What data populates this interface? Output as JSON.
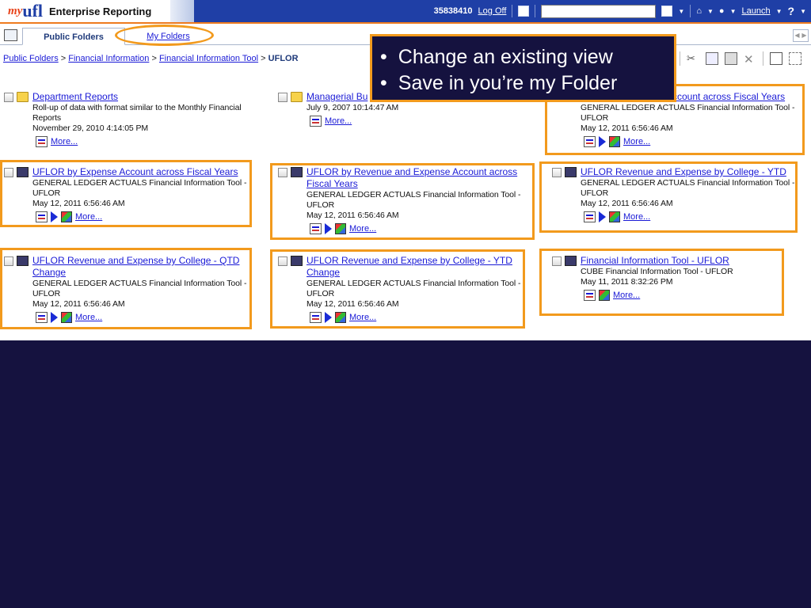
{
  "header": {
    "logo_my": "my",
    "logo_ufl": "ufl",
    "app_title": "Enterprise Reporting",
    "user_id": "35838410",
    "logoff_label": "Log Off",
    "launch_label": "Launch",
    "help_label": "?"
  },
  "tabs": {
    "public_folders": "Public Folders",
    "my_folders": "My Folders"
  },
  "breadcrumb": [
    {
      "label": "Public Folders",
      "link": true
    },
    {
      "label": "Financial Information",
      "link": true
    },
    {
      "label": "Financial Information Tool",
      "link": true
    },
    {
      "label": "UFLOR",
      "link": false
    }
  ],
  "breadcrumb_sep": ">",
  "entries": [
    {
      "title": "Department Reports",
      "icon": "folder-icon",
      "desc": "Roll-up of data with format similar to the Monthly Financial Reports",
      "date": "November 29, 2010 4:14:05 PM",
      "more": "More..."
    },
    {
      "title": "Managerial Bu",
      "icon": "folder-icon",
      "desc": "",
      "date": "July 9, 2007 10:14:47 AM",
      "more": "More..."
    },
    {
      "title": "ccount across Fiscal Years",
      "icon": "report-icon",
      "desc": "GENERAL LEDGER ACTUALS Financial Information Tool - UFLOR",
      "date": "May 12, 2011 6:56:46 AM",
      "more": "More..."
    },
    {
      "title": "UFLOR by Expense Account across Fiscal Years",
      "icon": "report-icon",
      "desc": "GENERAL LEDGER ACTUALS Financial Information Tool - UFLOR",
      "date": "May 12, 2011 6:56:46 AM",
      "more": "More..."
    },
    {
      "title": "UFLOR by Revenue and Expense Account across Fiscal Years",
      "icon": "report-icon",
      "desc": "GENERAL LEDGER ACTUALS Financial Information Tool - UFLOR",
      "date": "May 12, 2011 6:56:46 AM",
      "more": "More..."
    },
    {
      "title": "UFLOR Revenue and Expense by College - YTD",
      "icon": "report-icon",
      "desc": "GENERAL LEDGER ACTUALS Financial Information Tool - UFLOR",
      "date": "May 12, 2011 6:56:46 AM",
      "more": "More..."
    },
    {
      "title": "UFLOR Revenue and Expense by College - QTD Change",
      "icon": "report-icon",
      "desc": "GENERAL LEDGER ACTUALS Financial Information Tool - UFLOR",
      "date": "May 12, 2011 6:56:46 AM",
      "more": "More..."
    },
    {
      "title": "UFLOR Revenue and Expense by College - YTD Change",
      "icon": "report-icon",
      "desc": "GENERAL LEDGER ACTUALS Financial Information Tool - UFLOR",
      "date": "May 12, 2011 6:56:46 AM",
      "more": "More..."
    },
    {
      "title": "Financial Information Tool - UFLOR",
      "icon": "report-icon",
      "desc": "CUBE Financial Information Tool - UFLOR",
      "date": "May 11, 2011 8:32:26 PM",
      "more": "More..."
    }
  ],
  "callout": {
    "bullets": [
      "Change an existing view",
      "Save in you’re my Folder"
    ]
  },
  "colors": {
    "topbar": "#1f3fa6",
    "highlight": "#f29a1d",
    "slide_background": "#15123f",
    "link": "#1a1ad6"
  }
}
